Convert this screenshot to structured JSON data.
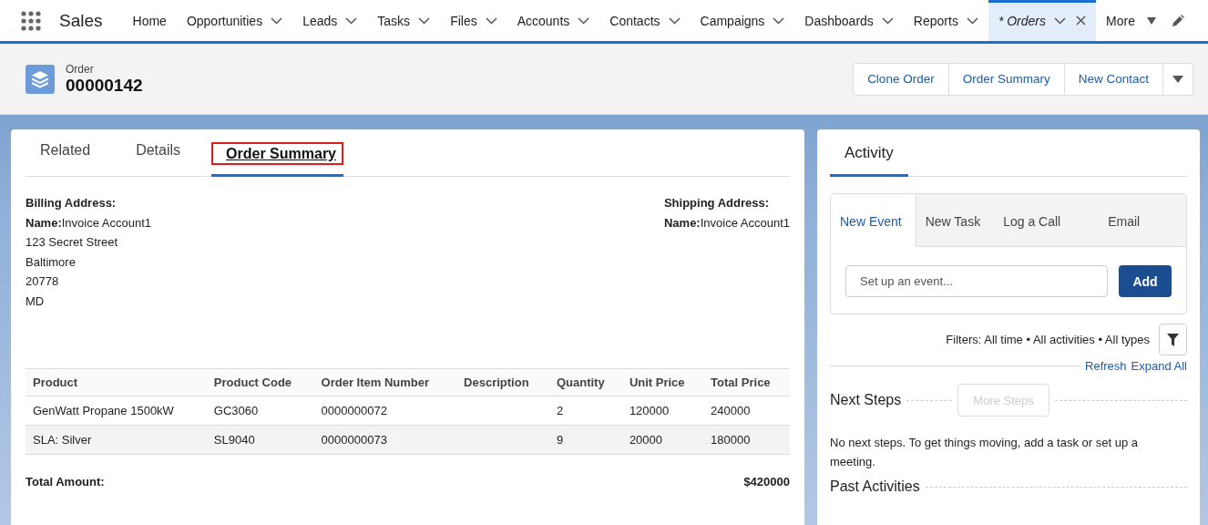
{
  "app": {
    "name": "Sales"
  },
  "nav": [
    {
      "label": "Home",
      "menu": false,
      "selected": false,
      "closable": false
    },
    {
      "label": "Opportunities",
      "menu": true,
      "selected": false,
      "closable": false
    },
    {
      "label": "Leads",
      "menu": true,
      "selected": false,
      "closable": false
    },
    {
      "label": "Tasks",
      "menu": true,
      "selected": false,
      "closable": false
    },
    {
      "label": "Files",
      "menu": true,
      "selected": false,
      "closable": false
    },
    {
      "label": "Accounts",
      "menu": true,
      "selected": false,
      "closable": false
    },
    {
      "label": "Contacts",
      "menu": true,
      "selected": false,
      "closable": false
    },
    {
      "label": "Campaigns",
      "menu": true,
      "selected": false,
      "closable": false
    },
    {
      "label": "Dashboards",
      "menu": true,
      "selected": false,
      "closable": false
    },
    {
      "label": "Reports",
      "menu": true,
      "selected": false,
      "closable": false
    },
    {
      "label": "* Orders",
      "menu": true,
      "selected": true,
      "closable": true
    }
  ],
  "more": {
    "label": "More"
  },
  "record": {
    "type": "Order",
    "number": "00000142",
    "actions": [
      "Clone Order",
      "Order Summary",
      "New Contact"
    ]
  },
  "tabs": [
    {
      "label": "Related",
      "selected": false,
      "outlined": false
    },
    {
      "label": "Details",
      "selected": false,
      "outlined": false
    },
    {
      "label": "Order Summary",
      "selected": true,
      "outlined": true
    }
  ],
  "billing": {
    "heading": "Billing Address:",
    "name_label": "Name:",
    "name": "Invoice Account1",
    "lines": [
      "123 Secret Street",
      "Baltimore",
      "20778",
      "MD"
    ]
  },
  "shipping": {
    "heading": "Shipping Address:",
    "name_label": "Name:",
    "name": "Invoice Account1"
  },
  "table": {
    "columns": [
      "Product",
      "Product Code",
      "Order Item Number",
      "Description",
      "Quantity",
      "Unit Price",
      "Total Price"
    ],
    "rows": [
      {
        "cells": [
          "GenWatt Propane 1500kW",
          "GC3060",
          "0000000072",
          "",
          "2",
          "120000",
          "240000"
        ],
        "highlighted": false
      },
      {
        "cells": [
          "SLA: Silver",
          "SL9040",
          "0000000073",
          "",
          "9",
          "20000",
          "180000"
        ],
        "highlighted": true
      }
    ]
  },
  "total": {
    "label": "Total Amount:",
    "value": "$420000"
  },
  "activity": {
    "title": "Activity",
    "tabs": [
      {
        "label": "New Event",
        "selected": true
      },
      {
        "label": "New Task",
        "selected": false
      },
      {
        "label": "Log a Call",
        "selected": false
      },
      {
        "label": "Email",
        "selected": false
      }
    ],
    "placeholder": "Set up an event...",
    "add": "Add",
    "filters": "Filters: All time • All activities • All types",
    "links": [
      "Refresh",
      "Expand All"
    ],
    "next_steps": "Next Steps",
    "more_steps": {
      "label": "More Steps",
      "disabled": true
    },
    "empty": "No next steps. To get things moving, add a task or set up a meeting.",
    "past": "Past Activities"
  }
}
